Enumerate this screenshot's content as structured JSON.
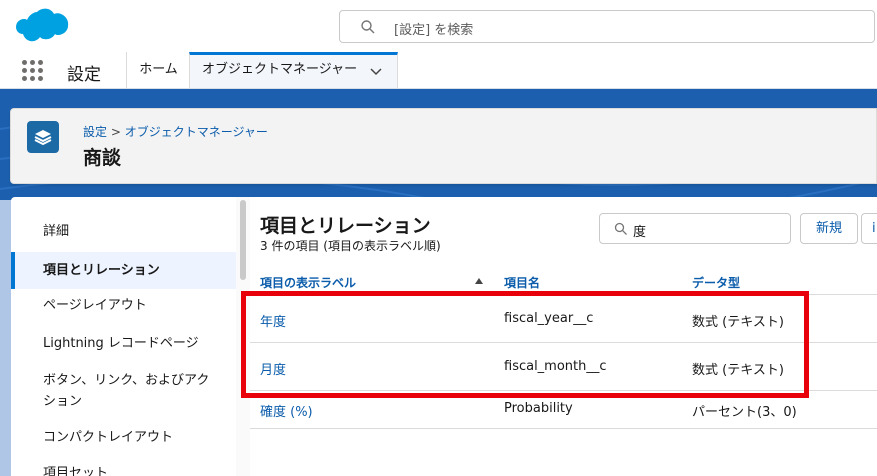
{
  "header": {
    "search_placeholder": "[設定] を検索"
  },
  "nav": {
    "app_name": "設定",
    "tabs": [
      {
        "label": "ホーム"
      },
      {
        "label": "オブジェクトマネージャー"
      }
    ]
  },
  "page_header": {
    "breadcrumb": [
      "設定",
      ">",
      "オブジェクトマネージャー"
    ],
    "title": "商談"
  },
  "sidebar": {
    "items": [
      {
        "label": "詳細"
      },
      {
        "label": "項目とリレーション"
      },
      {
        "label": "ページレイアウト"
      },
      {
        "label": "Lightning レコードページ"
      },
      {
        "label": "ボタン、リンク、およびアク"
      },
      {
        "label": "ション"
      },
      {
        "label": "コンパクトレイアウト"
      },
      {
        "label": "項目セット"
      }
    ]
  },
  "main": {
    "title": "項目とリレーション",
    "subtitle": "3 件の項目 (項目の表示ラベル順)",
    "quick_find_value": "度",
    "new_button": "新規",
    "more_button": "i",
    "columns": [
      "項目の表示ラベル",
      "項目名",
      "データ型"
    ],
    "rows": [
      {
        "label": "年度",
        "name": "fiscal_year__c",
        "type": "数式 (テキスト)"
      },
      {
        "label": "月度",
        "name": "fiscal_month__c",
        "type": "数式 (テキスト)"
      },
      {
        "label": "確度 (%)",
        "name": "Probability",
        "type": "パーセント(3、0)"
      }
    ]
  },
  "colors": {
    "brand_blue": "#0176d3",
    "link": "#0b5cab",
    "highlight_red": "#e8000b",
    "object_icon": "#1b6aa5"
  }
}
